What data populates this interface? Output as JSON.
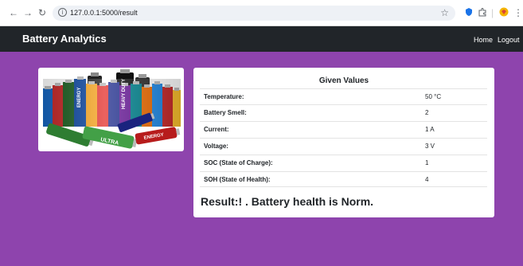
{
  "browser": {
    "url": "127.0.0.1:5000/result",
    "back_glyph": "←",
    "forward_glyph": "→",
    "reload_glyph": "↻",
    "info_glyph": "i",
    "star_glyph": "☆",
    "menu_glyph": "⋮"
  },
  "app": {
    "brand": "Battery Analytics",
    "nav": {
      "home": "Home",
      "logout": "Logout"
    },
    "background": "#8e44ad",
    "navbar_color": "#212529"
  },
  "values": {
    "title": "Given Values",
    "rows": [
      {
        "label": "Temperature:",
        "value": "50 °C"
      },
      {
        "label": "Battery Smell:",
        "value": "2"
      },
      {
        "label": "Current:",
        "value": "1 A"
      },
      {
        "label": "Voltage:",
        "value": "3 V"
      },
      {
        "label": "SOC (State of Charge):",
        "value": "1"
      },
      {
        "label": "SOH (State of Health):",
        "value": "4"
      }
    ],
    "result": "Result:! . Battery health is Norm."
  },
  "image": {
    "battery_labels": [
      "ENERGY",
      "HEAVY DUTY",
      "ULTRA",
      "ENERGY"
    ]
  }
}
